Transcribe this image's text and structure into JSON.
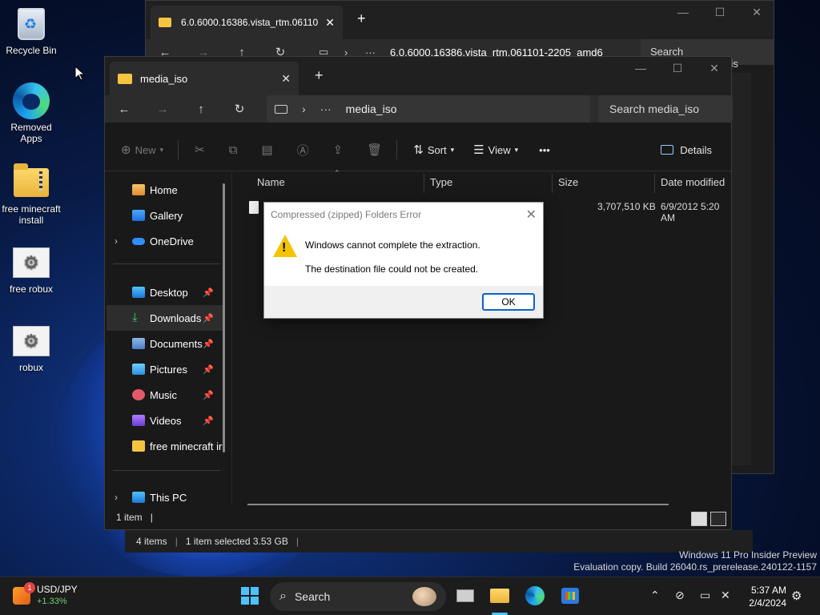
{
  "desktop": {
    "icons": [
      {
        "label": "Recycle Bin",
        "icon": "recycle-bin-icon"
      },
      {
        "label": "Removed Apps",
        "icon": "edge-icon"
      },
      {
        "label": "free minecraft install",
        "icon": "zip-folder-icon"
      },
      {
        "label": "free robux",
        "icon": "settings-file-icon"
      },
      {
        "label": "robux",
        "icon": "settings-file-icon"
      }
    ]
  },
  "back_window": {
    "tab_title": "6.0.6000.16386.vista_rtm.06110",
    "path": "6.0.6000.16386.vista_rtm.061101-2205_amd6",
    "search": "Search 6.0.6000.16386.vis"
  },
  "front_window": {
    "tab_title": "media_iso",
    "path": "media_iso",
    "search_placeholder": "Search media_iso",
    "toolbar": {
      "new_label": "New",
      "sort_label": "Sort",
      "view_label": "View",
      "more_label": "•••",
      "details_label": "Details"
    },
    "sidebar": {
      "items": [
        {
          "label": "Home"
        },
        {
          "label": "Gallery"
        },
        {
          "label": "OneDrive"
        },
        {
          "label": "Desktop"
        },
        {
          "label": "Downloads"
        },
        {
          "label": "Documents"
        },
        {
          "label": "Pictures"
        },
        {
          "label": "Music"
        },
        {
          "label": "Videos"
        },
        {
          "label": "free minecraft ir"
        },
        {
          "label": "This PC"
        }
      ]
    },
    "columns": {
      "name": "Name",
      "type": "Type",
      "size": "Size",
      "date": "Date modified"
    },
    "file": {
      "size": "3,707,510 KB",
      "date": "6/9/2012 5:20 AM"
    },
    "status": "1 item",
    "status_cursor": "|"
  },
  "bottom_status": {
    "items": "4 items",
    "selected": "1 item selected  3.53 GB",
    "sep": "|"
  },
  "dialog": {
    "title": "Compressed (zipped) Folders Error",
    "message1": "Windows cannot complete the extraction.",
    "message2": "The destination file could not be created.",
    "ok_label": "OK",
    "close_label": "✕"
  },
  "watermark": {
    "line1": "Windows 11 Pro Insider Preview",
    "line2": "Evaluation copy. Build 26040.rs_prerelease.240122-1157"
  },
  "taskbar": {
    "widget_title": "USD/JPY",
    "widget_value": "+1.33%",
    "widget_badge": "1",
    "search_label": "Search",
    "time": "5:37 AM",
    "date": "2/4/2024"
  }
}
